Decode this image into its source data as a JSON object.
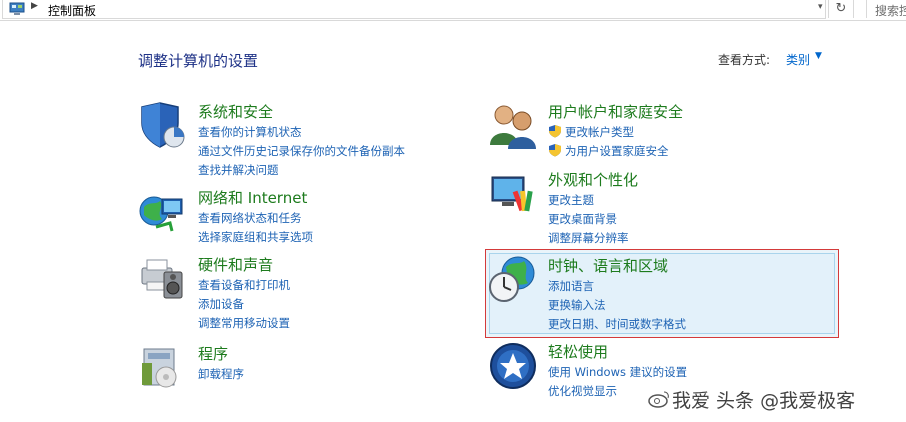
{
  "address_bar": {
    "breadcrumb": "控制面板",
    "search_placeholder": "搜索控"
  },
  "header": {
    "title": "调整计算机的设置",
    "view_by_label": "查看方式:",
    "view_by_value": "类别"
  },
  "categories": [
    {
      "title": "系统和安全",
      "icon": "security-shield-icon",
      "links": [
        "查看你的计算机状态",
        "通过文件历史记录保存你的文件备份副本",
        "查找并解决问题"
      ]
    },
    {
      "title": "网络和 Internet",
      "icon": "network-globe-icon",
      "links": [
        "查看网络状态和任务",
        "选择家庭组和共享选项"
      ]
    },
    {
      "title": "硬件和声音",
      "icon": "printer-speaker-icon",
      "links": [
        "查看设备和打印机",
        "添加设备",
        "调整常用移动设置"
      ]
    },
    {
      "title": "程序",
      "icon": "programs-box-icon",
      "links": [
        "卸载程序"
      ]
    },
    {
      "title": "用户帐户和家庭安全",
      "icon": "users-icon",
      "links": [
        "更改帐户类型",
        "为用户设置家庭安全"
      ]
    },
    {
      "title": "外观和个性化",
      "icon": "monitor-palette-icon",
      "links": [
        "更改主题",
        "更改桌面背景",
        "调整屏幕分辨率"
      ]
    },
    {
      "title": "时钟、语言和区域",
      "icon": "clock-globe-icon",
      "links": [
        "添加语言",
        "更换输入法",
        "更改日期、时间或数字格式"
      ]
    },
    {
      "title": "轻松使用",
      "icon": "ease-of-access-icon",
      "links": [
        "使用 Windows 建议的设置",
        "优化视觉显示"
      ]
    }
  ],
  "watermark": "我爱 头条 @我爱极客"
}
